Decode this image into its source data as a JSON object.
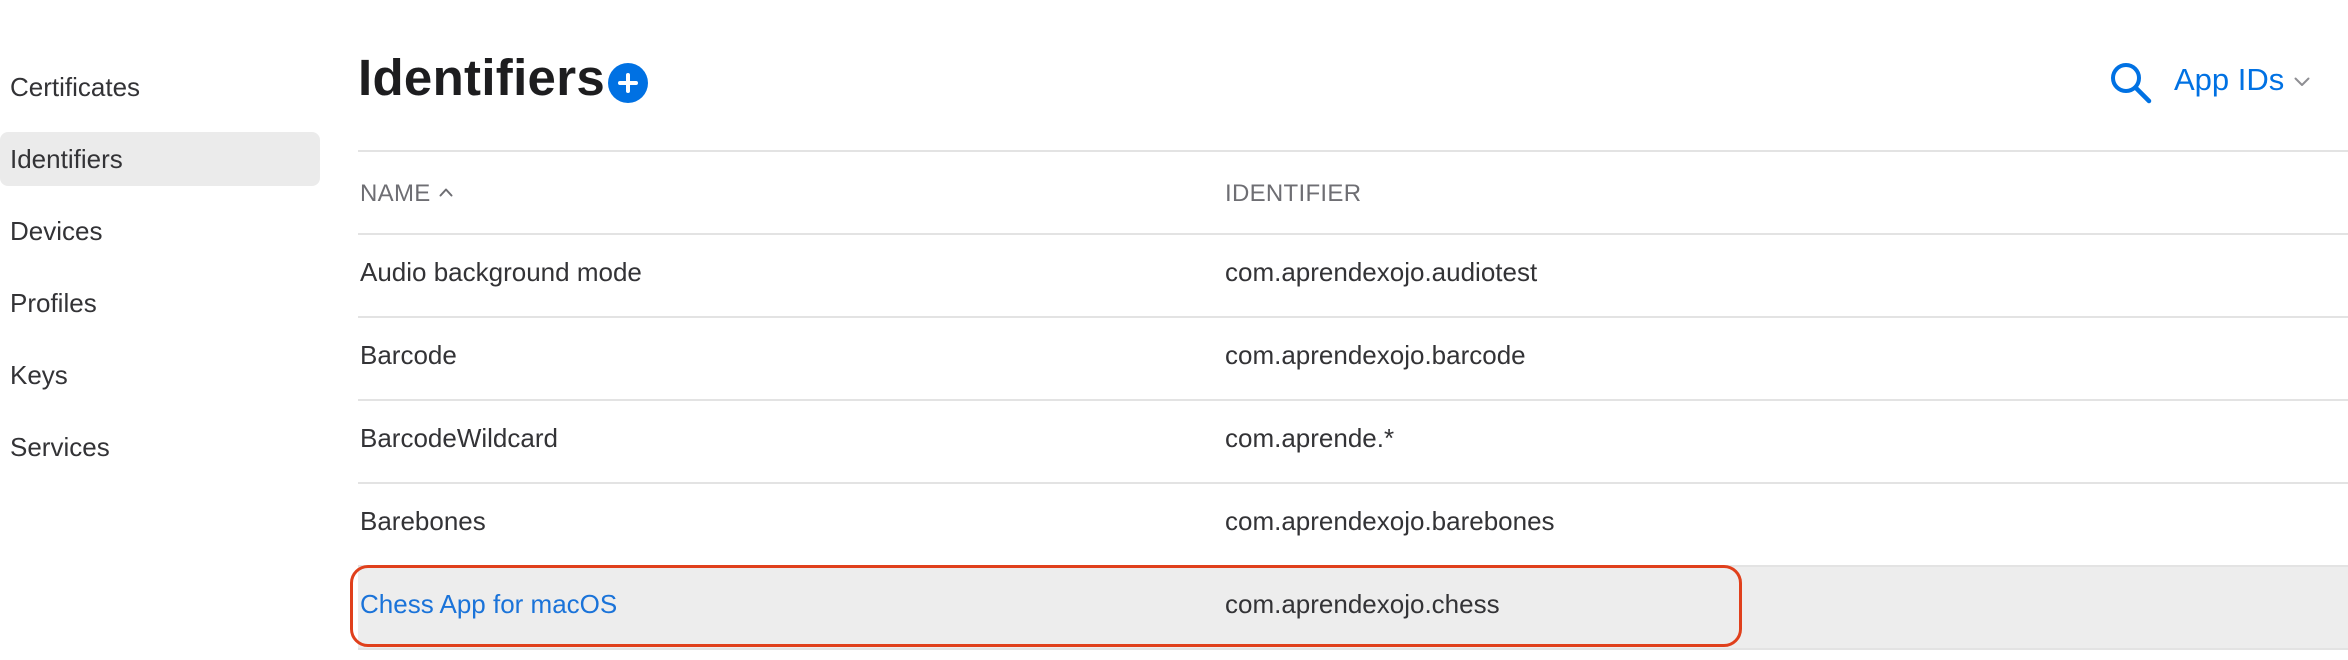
{
  "sidebar": {
    "items": [
      {
        "label": "Certificates"
      },
      {
        "label": "Identifiers"
      },
      {
        "label": "Devices"
      },
      {
        "label": "Profiles"
      },
      {
        "label": "Keys"
      },
      {
        "label": "Services"
      }
    ],
    "active": "Identifiers"
  },
  "header": {
    "title": "Identifiers",
    "add_icon": "plus-circle-icon",
    "search_icon": "search-icon",
    "filter": {
      "selected": "App IDs",
      "icon": "chevron-down-icon"
    }
  },
  "table": {
    "columns": [
      {
        "label": "NAME",
        "sort": "ascending"
      },
      {
        "label": "IDENTIFIER"
      }
    ],
    "rows": [
      {
        "name": "Audio background mode",
        "identifier": "com.aprendexojo.audiotest"
      },
      {
        "name": "Barcode",
        "identifier": "com.aprendexojo.barcode"
      },
      {
        "name": "BarcodeWildcard",
        "identifier": "com.aprende.*"
      },
      {
        "name": "Barebones",
        "identifier": "com.aprendexojo.barebones"
      },
      {
        "name": "Chess App for macOS",
        "identifier": "com.aprendexojo.chess",
        "selected": true
      }
    ]
  },
  "colors": {
    "accent": "#0071e3",
    "link": "#1a73d9",
    "highlight_outline": "#e0401c",
    "selected_row_bg": "#ededed"
  }
}
